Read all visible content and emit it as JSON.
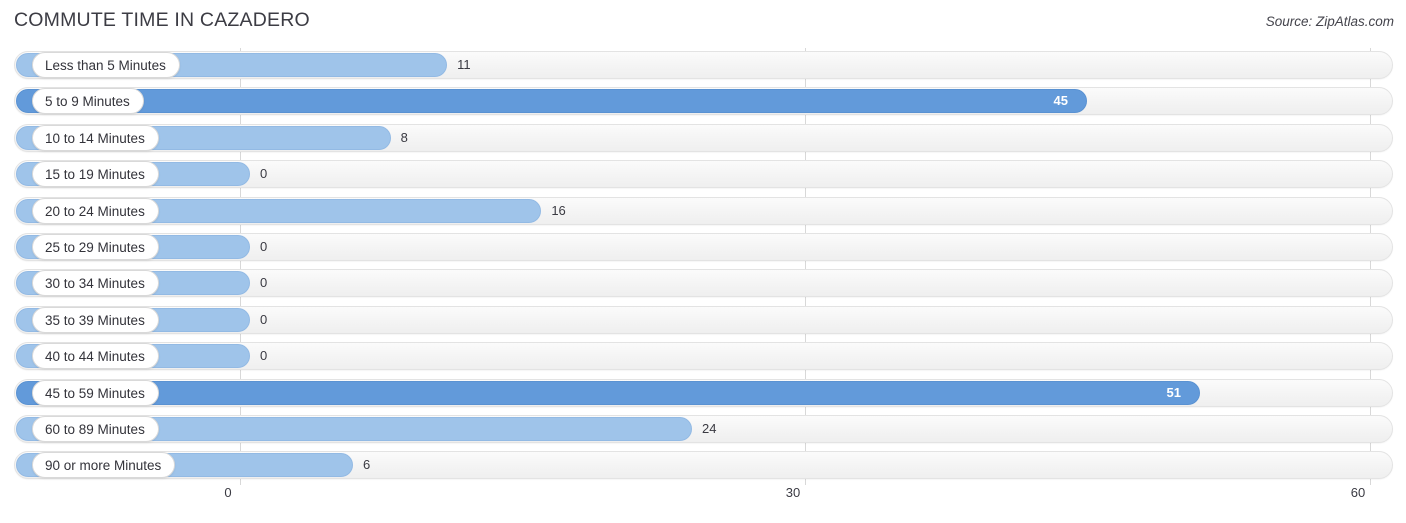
{
  "header": {
    "title": "COMMUTE TIME IN CAZADERO",
    "source": "Source: ZipAtlas.com"
  },
  "colors": {
    "bar_light": "#9fc4ea",
    "bar_dark": "#629ada",
    "track": "#f4f4f4",
    "gridline": "#d8d8d8",
    "text": "#3a3a42"
  },
  "chart_data": {
    "type": "bar",
    "orientation": "horizontal",
    "title": "COMMUTE TIME IN CAZADERO",
    "xlabel": "",
    "ylabel": "",
    "xlim": [
      0,
      60
    ],
    "xticks": [
      0,
      30,
      60
    ],
    "xtick_labels": [
      "0",
      "30",
      "60"
    ],
    "grid": true,
    "legend": false,
    "categories": [
      "Less than 5 Minutes",
      "5 to 9 Minutes",
      "10 to 14 Minutes",
      "15 to 19 Minutes",
      "20 to 24 Minutes",
      "25 to 29 Minutes",
      "30 to 34 Minutes",
      "35 to 39 Minutes",
      "40 to 44 Minutes",
      "45 to 59 Minutes",
      "60 to 89 Minutes",
      "90 or more Minutes"
    ],
    "values": [
      11,
      45,
      8,
      0,
      16,
      0,
      0,
      0,
      0,
      51,
      24,
      6
    ],
    "value_labels": [
      "11",
      "45",
      "8",
      "0",
      "16",
      "0",
      "0",
      "0",
      "0",
      "51",
      "24",
      "6"
    ]
  },
  "rows": [
    {
      "label": "Less than 5 Minutes",
      "value_label": "11"
    },
    {
      "label": "5 to 9 Minutes",
      "value_label": "45"
    },
    {
      "label": "10 to 14 Minutes",
      "value_label": "8"
    },
    {
      "label": "15 to 19 Minutes",
      "value_label": "0"
    },
    {
      "label": "20 to 24 Minutes",
      "value_label": "16"
    },
    {
      "label": "25 to 29 Minutes",
      "value_label": "0"
    },
    {
      "label": "30 to 34 Minutes",
      "value_label": "0"
    },
    {
      "label": "35 to 39 Minutes",
      "value_label": "0"
    },
    {
      "label": "40 to 44 Minutes",
      "value_label": "0"
    },
    {
      "label": "45 to 59 Minutes",
      "value_label": "51"
    },
    {
      "label": "60 to 89 Minutes",
      "value_label": "24"
    },
    {
      "label": "90 or more Minutes",
      "value_label": "6"
    }
  ],
  "axis": {
    "ticks": [
      {
        "label": "0"
      },
      {
        "label": "30"
      },
      {
        "label": "60"
      }
    ]
  }
}
